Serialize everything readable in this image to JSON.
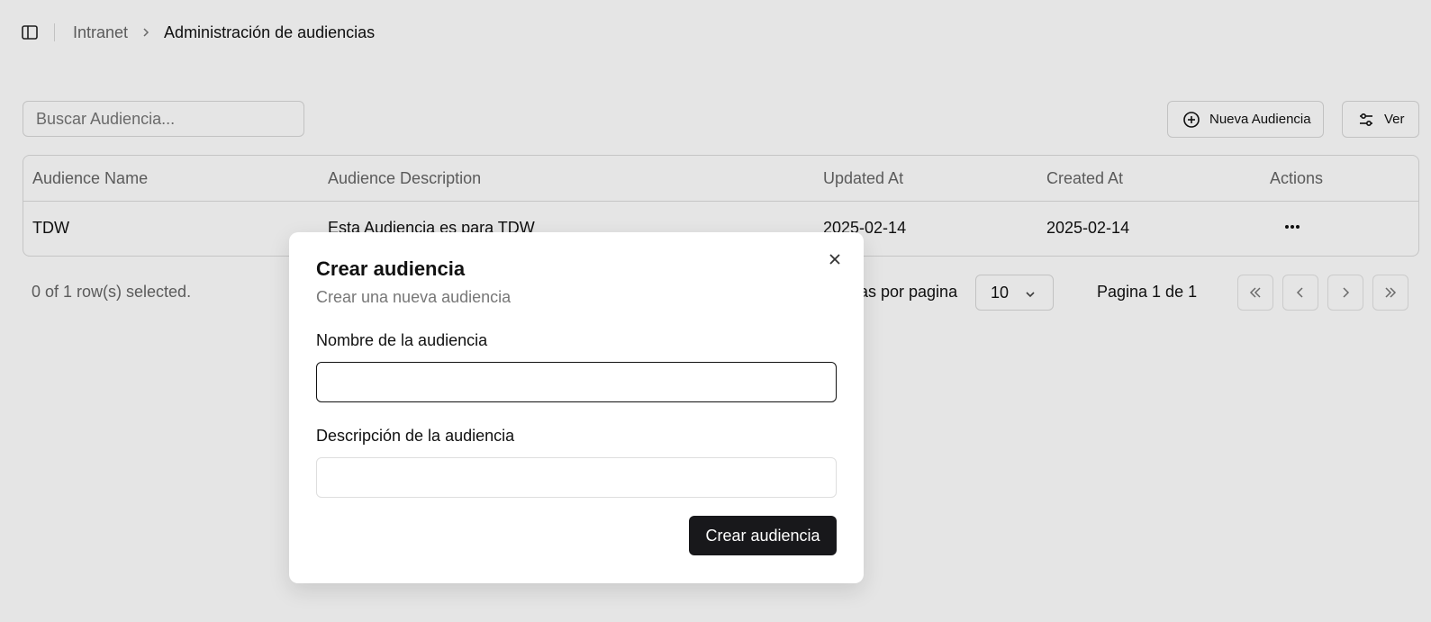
{
  "breadcrumb": {
    "root": "Intranet",
    "current": "Administración de audiencias"
  },
  "toolbar": {
    "search_placeholder": "Buscar Audiencia...",
    "new_button": "Nueva Audiencia",
    "view_button": "Ver"
  },
  "table": {
    "columns": [
      "Audience Name",
      "Audience Description",
      "Updated At",
      "Created At",
      "Actions"
    ],
    "rows": [
      {
        "name": "TDW",
        "description": "Esta Audiencia es para TDW",
        "updated_at": "2025-02-14",
        "created_at": "2025-02-14"
      }
    ]
  },
  "footer": {
    "selected_text": "0 of 1 row(s) selected.",
    "rows_per_page_label": "Filas por pagina",
    "rows_per_page_value": "10",
    "page_info": "Pagina 1 de 1"
  },
  "dialog": {
    "title": "Crear audiencia",
    "subtitle": "Crear una nueva audiencia",
    "name_label": "Nombre de la audiencia",
    "name_value": "",
    "desc_label": "Descripción de la audiencia",
    "desc_value": "",
    "submit_label": "Crear audiencia"
  },
  "icons": {
    "sidebar_toggle": "sidebar-panel-icon",
    "breadcrumb_separator": "chevron-right-icon",
    "new": "plus-circle-icon",
    "view": "sliders-icon",
    "row_actions": "more-horizontal-icon",
    "select_chevron": "chevron-down-icon",
    "first_page": "chevrons-left-icon",
    "prev_page": "chevron-left-icon",
    "next_page": "chevron-right-icon",
    "last_page": "chevrons-right-icon",
    "close": "close-icon"
  },
  "colors": {
    "primary_button": "#18181b",
    "overlay": "rgba(0,0,0,0.10)"
  }
}
